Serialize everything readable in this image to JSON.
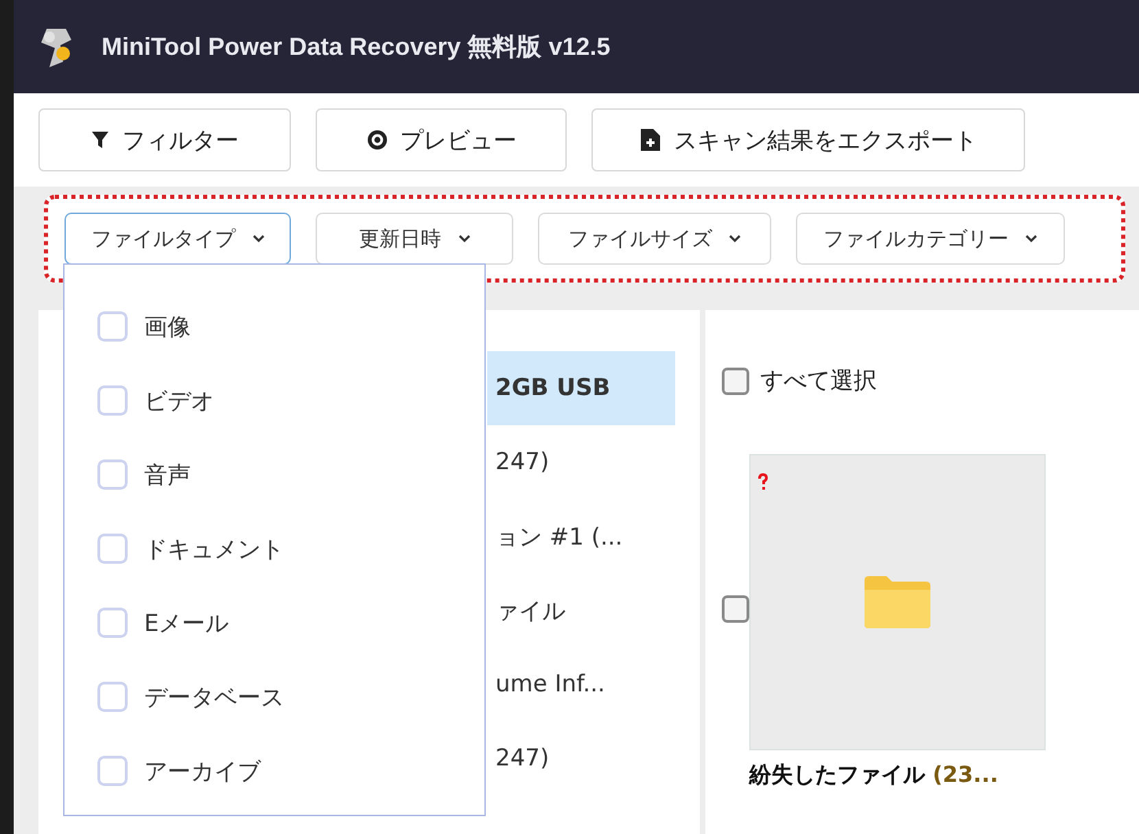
{
  "window": {
    "title": "MiniTool Power Data Recovery 無料版 v12.5"
  },
  "toolbar": [
    {
      "kind": "filter",
      "label": "フィルター"
    },
    {
      "kind": "preview",
      "label": "プレビュー"
    },
    {
      "kind": "export",
      "label": "スキャン結果をエクスポート"
    }
  ],
  "filters": [
    {
      "label": "ファイルタイプ",
      "selected": true
    },
    {
      "label": "更新日時",
      "selected": false
    },
    {
      "label": "ファイルサイズ",
      "selected": false
    },
    {
      "label": "ファイルカテゴリー",
      "selected": false
    }
  ],
  "dropdown": {
    "options": [
      {
        "label": "画像",
        "checked": false
      },
      {
        "label": "ビデオ",
        "checked": false
      },
      {
        "label": "音声",
        "checked": false
      },
      {
        "label": "ドキュメント",
        "checked": false
      },
      {
        "label": "Eメール",
        "checked": false
      },
      {
        "label": "データベース",
        "checked": false
      },
      {
        "label": "アーカイブ",
        "checked": false
      }
    ]
  },
  "tree": {
    "items": [
      {
        "label": "2GB USB",
        "selected": true
      },
      {
        "label": "247)",
        "selected": false
      },
      {
        "label": "ョン #1 (...",
        "selected": false
      },
      {
        "label": "ァイル",
        "selected": false
      },
      {
        "label": "ume Inf...",
        "selected": false
      },
      {
        "label": "247)",
        "selected": false
      }
    ]
  },
  "files": {
    "select_all": {
      "label": "すべて選択",
      "checked": false
    },
    "items": [
      {
        "name": "紛失したファイル",
        "count": "(23...",
        "checked": false,
        "unknown": true
      }
    ]
  }
}
